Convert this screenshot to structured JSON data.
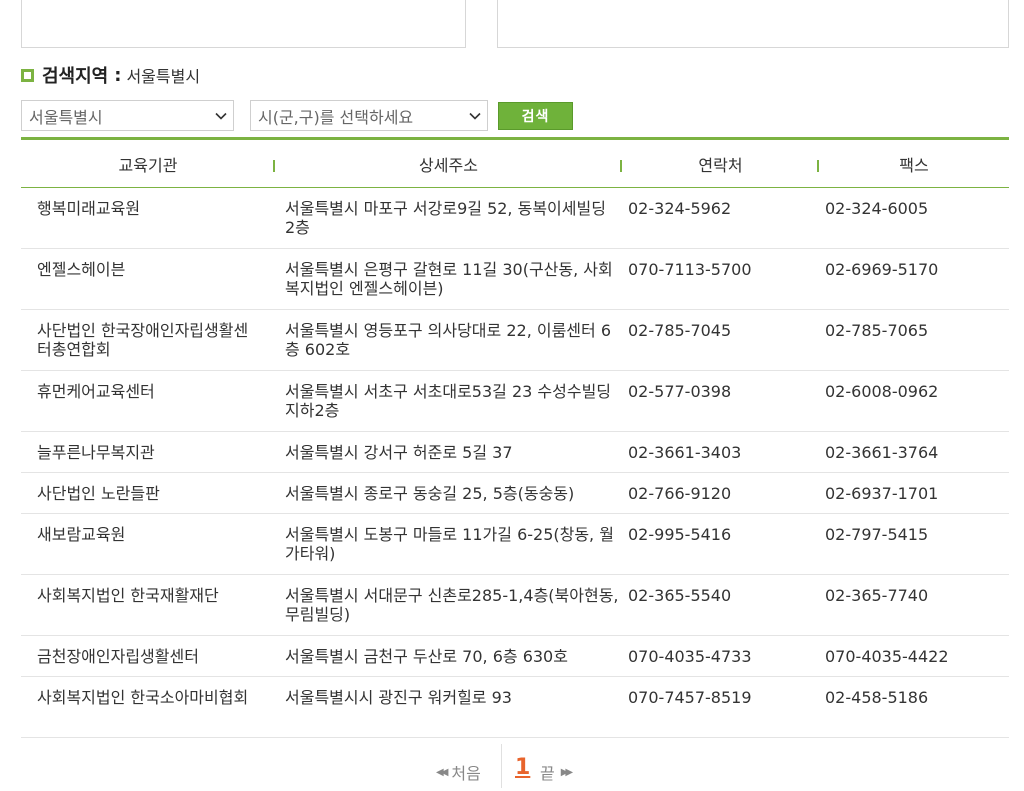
{
  "region": {
    "label": "검색지역",
    "colon": ":",
    "value": "서울특별시"
  },
  "search": {
    "city_select": "서울특별시",
    "district_select": "시(군,구)를 선택하세요",
    "button_label": "검색"
  },
  "table": {
    "headers": [
      "교육기관",
      "상세주소",
      "연락처",
      "팩스"
    ],
    "rows": [
      {
        "name": "행복미래교육원",
        "address": "서울특별시 마포구 서강로9길 52, 동복이세빌딩 2층",
        "tel": "02-324-5962",
        "fax": "02-324-6005"
      },
      {
        "name": "엔젤스헤이븐",
        "address": "서울특별시 은평구 갈현로 11길 30(구산동, 사회복지법인 엔젤스헤이븐)",
        "tel": "070-7113-5700",
        "fax": "02-6969-5170"
      },
      {
        "name": "사단법인 한국장애인자립생활센터총연합회",
        "address": "서울특별시 영등포구 의사당대로 22, 이룸센터 6층 602호",
        "tel": "02-785-7045",
        "fax": "02-785-7065"
      },
      {
        "name": "휴먼케어교육센터",
        "address": "서울특별시 서초구 서초대로53길 23 수성수빌딩 지하2층",
        "tel": "02-577-0398",
        "fax": "02-6008-0962"
      },
      {
        "name": "늘푸른나무복지관",
        "address": "서울특별시 강서구 허준로 5길 37",
        "tel": "02-3661-3403",
        "fax": "02-3661-3764"
      },
      {
        "name": "사단법인 노란들판",
        "address": "서울특별시 종로구 동숭길 25, 5층(동숭동)",
        "tel": "02-766-9120",
        "fax": "02-6937-1701"
      },
      {
        "name": "새보람교육원",
        "address": "서울특별시 도봉구 마들로 11가길 6-25(창동, 월가타워)",
        "tel": "02-995-5416",
        "fax": "02-797-5415"
      },
      {
        "name": "사회복지법인 한국재활재단",
        "address": "서울특별시 서대문구 신촌로285-1,4층(북아현동, 무림빌딩)",
        "tel": "02-365-5540",
        "fax": "02-365-7740"
      },
      {
        "name": "금천장애인자립생활센터",
        "address": "서울특별시 금천구 두산로 70, 6층 630호",
        "tel": "070-4035-4733",
        "fax": "070-4035-4422"
      },
      {
        "name": "사회복지법인 한국소아마비협회",
        "address": "서울특별시시 광진구 워커힐로 93",
        "tel": "070-7457-8519",
        "fax": "02-458-5186"
      }
    ]
  },
  "pager": {
    "first_label": "처음",
    "current_page": "1",
    "last_label": "끝"
  },
  "colors": {
    "accent": "#7cb342",
    "button": "#6fb23a",
    "current_page": "#e8642c"
  }
}
